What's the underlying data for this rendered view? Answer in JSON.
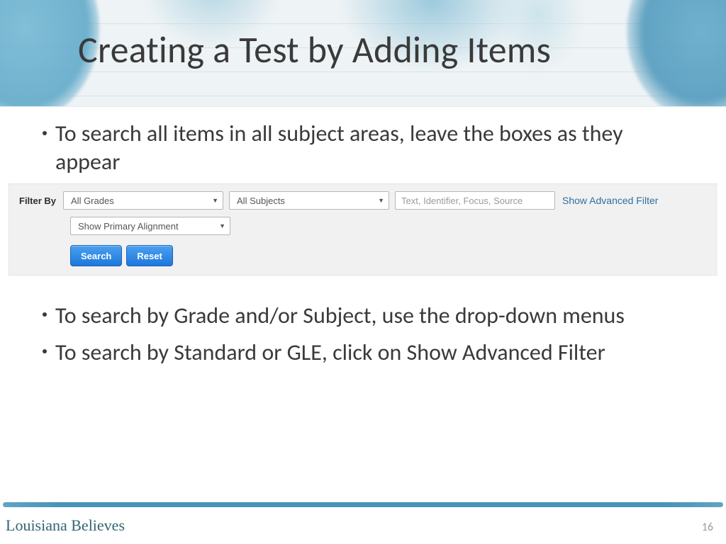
{
  "slide": {
    "title": "Creating a Test by Adding Items",
    "bullets": {
      "b1": "To search all items in all subject areas, leave the boxes as they appear",
      "b2": "To search by Grade and/or Subject, use the drop-down menus",
      "b3": "To search by Standard or GLE, click on Show Advanced Filter"
    },
    "page_number": "16",
    "tagline": "Louisiana Believes"
  },
  "filter": {
    "label": "Filter By",
    "grades": "All Grades",
    "subjects": "All Subjects",
    "textbox_placeholder": "Text, Identifier, Focus, Source",
    "advanced_link": "Show Advanced Filter",
    "primary_alignment": "Show Primary Alignment",
    "search_btn": "Search",
    "reset_btn": "Reset"
  }
}
